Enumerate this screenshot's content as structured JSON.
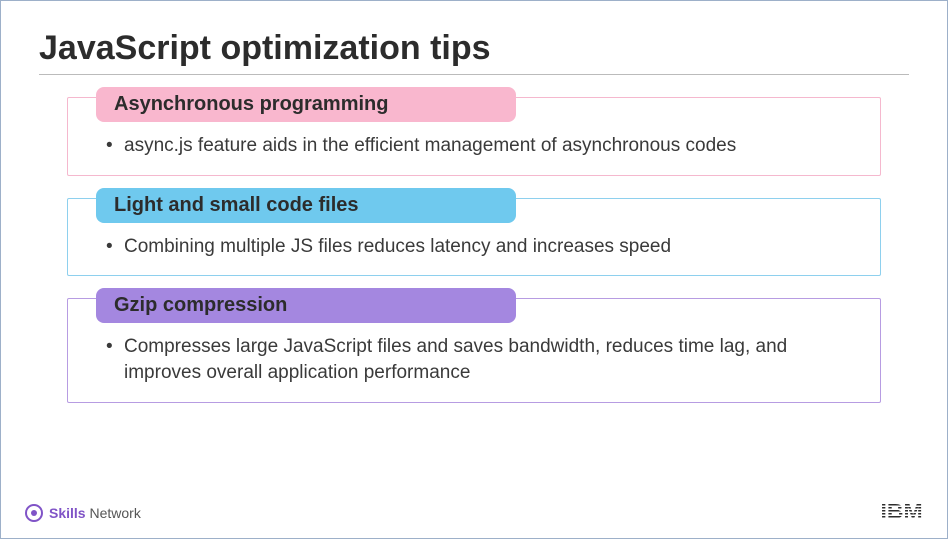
{
  "title": "JavaScript optimization tips",
  "tips": [
    {
      "heading": "Asynchronous programming",
      "body": "async.js feature aids in the efficient management of asynchronous codes"
    },
    {
      "heading": "Light and small code files",
      "body": "Combining multiple JS files reduces latency and increases speed"
    },
    {
      "heading": "Gzip compression",
      "body": "Compresses large JavaScript files and saves bandwidth, reduces time lag, and improves overall application performance"
    }
  ],
  "footer": {
    "skills": "Skills",
    "network": "Network",
    "ibm": "IBM"
  }
}
